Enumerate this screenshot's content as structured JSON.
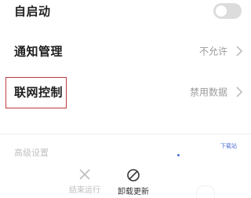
{
  "settings": {
    "autostart": {
      "label": "自启动",
      "enabled": false
    },
    "notification": {
      "label": "通知管理",
      "value": "不允许"
    },
    "network": {
      "label": "联网控制",
      "value": "禁用数据"
    },
    "faded_row": {
      "label": "高级设置"
    },
    "download_tag": "下载站"
  },
  "actions": {
    "force_stop": {
      "label": "结束运行",
      "icon": "close-icon",
      "enabled": false
    },
    "uninstall_updates": {
      "label": "卸载更新",
      "icon": "block-icon",
      "enabled": true
    }
  },
  "colors": {
    "highlight_border": "#c0393b",
    "toggle_off": "#dcdcdc",
    "secondary_text": "#9a9a9a",
    "accent_blue": "#4a6fd6"
  }
}
